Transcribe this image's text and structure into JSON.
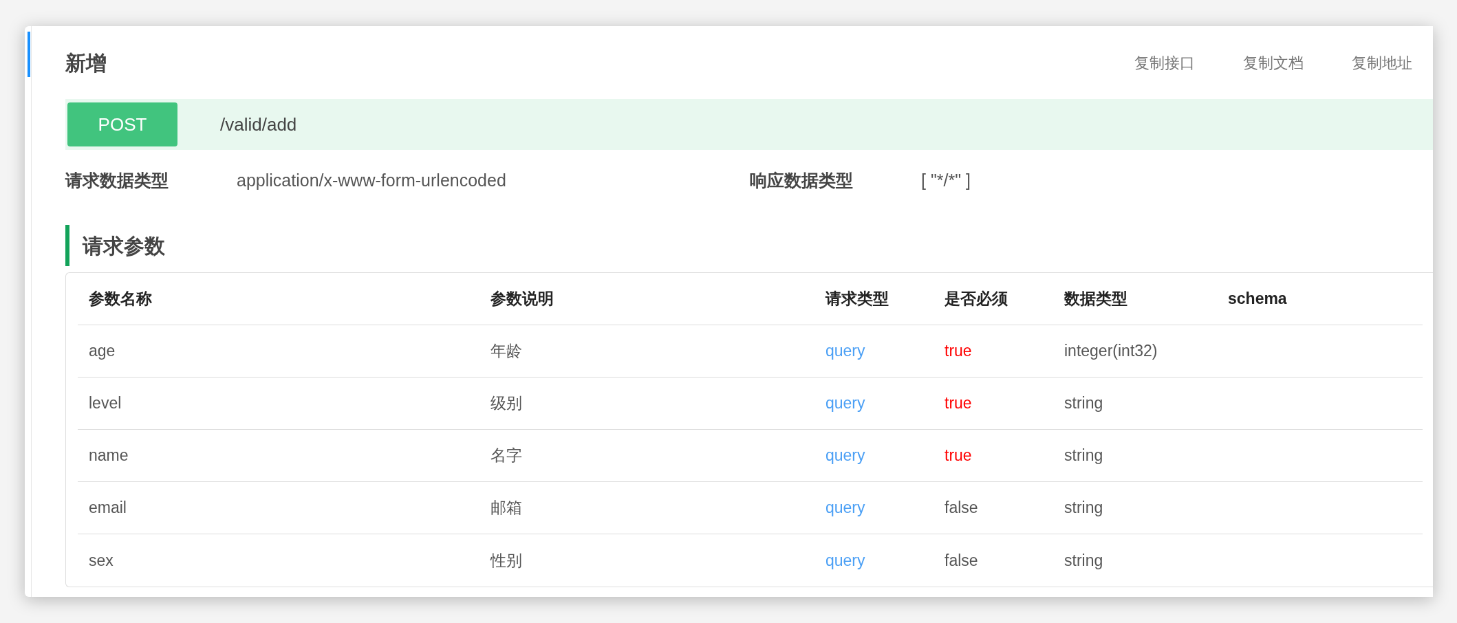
{
  "header": {
    "title": "新增",
    "actions": [
      "复制接口",
      "复制文档",
      "复制地址"
    ]
  },
  "endpoint": {
    "method": "POST",
    "path": "/valid/add"
  },
  "meta": [
    {
      "label": "请求数据类型",
      "value": "application/x-www-form-urlencoded"
    },
    {
      "label": "响应数据类型",
      "value": "[ \"*/*\" ]"
    }
  ],
  "section": {
    "title": "请求参数"
  },
  "table": {
    "columns": [
      "参数名称",
      "参数说明",
      "请求类型",
      "是否必须",
      "数据类型",
      "schema"
    ],
    "rows": [
      {
        "name": "age",
        "description": "年龄",
        "in": "query",
        "required_text": "true",
        "required": true,
        "type": "integer(int32)"
      },
      {
        "name": "level",
        "description": "级别",
        "in": "query",
        "required_text": "true",
        "required": true,
        "type": "string"
      },
      {
        "name": "name",
        "description": "名字",
        "in": "query",
        "required_text": "true",
        "required": true,
        "type": "string"
      },
      {
        "name": "email",
        "description": "邮箱",
        "in": "query",
        "required_text": "false",
        "required": false,
        "type": "string"
      },
      {
        "name": "sex",
        "description": "性别",
        "in": "query",
        "required_text": "false",
        "required": false,
        "type": "string"
      }
    ]
  }
}
